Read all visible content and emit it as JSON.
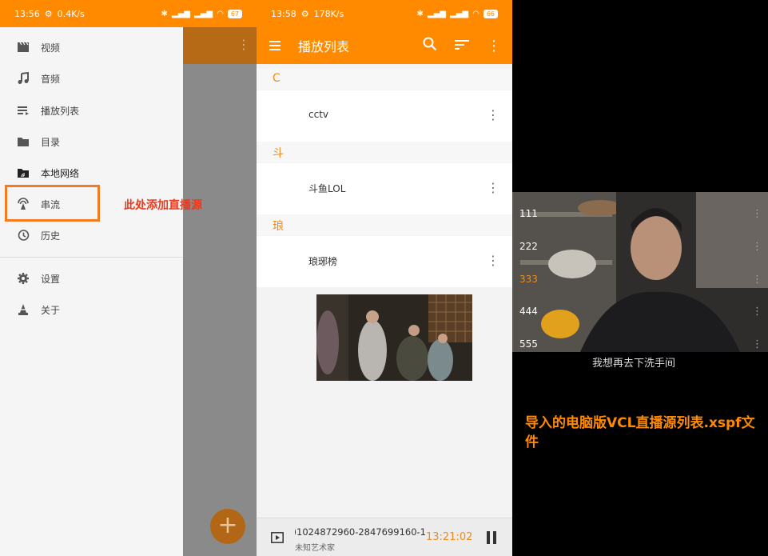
{
  "panel1": {
    "status": {
      "time": "13:56",
      "speed": "0.4K/s",
      "battery": "67"
    },
    "drawer": {
      "items": [
        {
          "label": "视频",
          "icon": "video-clapper-icon"
        },
        {
          "label": "音频",
          "icon": "music-note-icon"
        },
        {
          "label": "播放列表",
          "icon": "playlist-icon"
        },
        {
          "label": "目录",
          "icon": "folder-icon"
        },
        {
          "label": "本地网络",
          "icon": "network-folder-icon"
        },
        {
          "label": "串流",
          "icon": "stream-antenna-icon"
        },
        {
          "label": "历史",
          "icon": "history-icon"
        },
        {
          "label": "设置",
          "icon": "gear-icon"
        },
        {
          "label": "关于",
          "icon": "vlc-cone-icon"
        }
      ]
    },
    "annotation": "此处添加直播源",
    "fab_label": "+"
  },
  "panel2": {
    "status": {
      "time": "13:58",
      "speed": "178K/s",
      "battery": "66"
    },
    "toolbar": {
      "title": "播放列表"
    },
    "sections": [
      {
        "letter": "C",
        "item": "cctv"
      },
      {
        "letter": "斗",
        "item": "斗鱼LOL"
      },
      {
        "letter": "琅",
        "item": "琅琊榜"
      }
    ],
    "miniplayer": {
      "track": "1024872960-2847699160-1(",
      "artist": "未知艺术家",
      "time": "13:21:02"
    }
  },
  "panel3": {
    "channels": [
      "111",
      "222",
      "333",
      "444",
      "555"
    ],
    "active_channel": "333",
    "subtitle": "我想再去下洗手间",
    "annotation": "导入的电脑版VCL直播源列表.xspf文件"
  },
  "colors": {
    "accent": "#ff8a00",
    "annotation_red": "#e93a1e"
  }
}
